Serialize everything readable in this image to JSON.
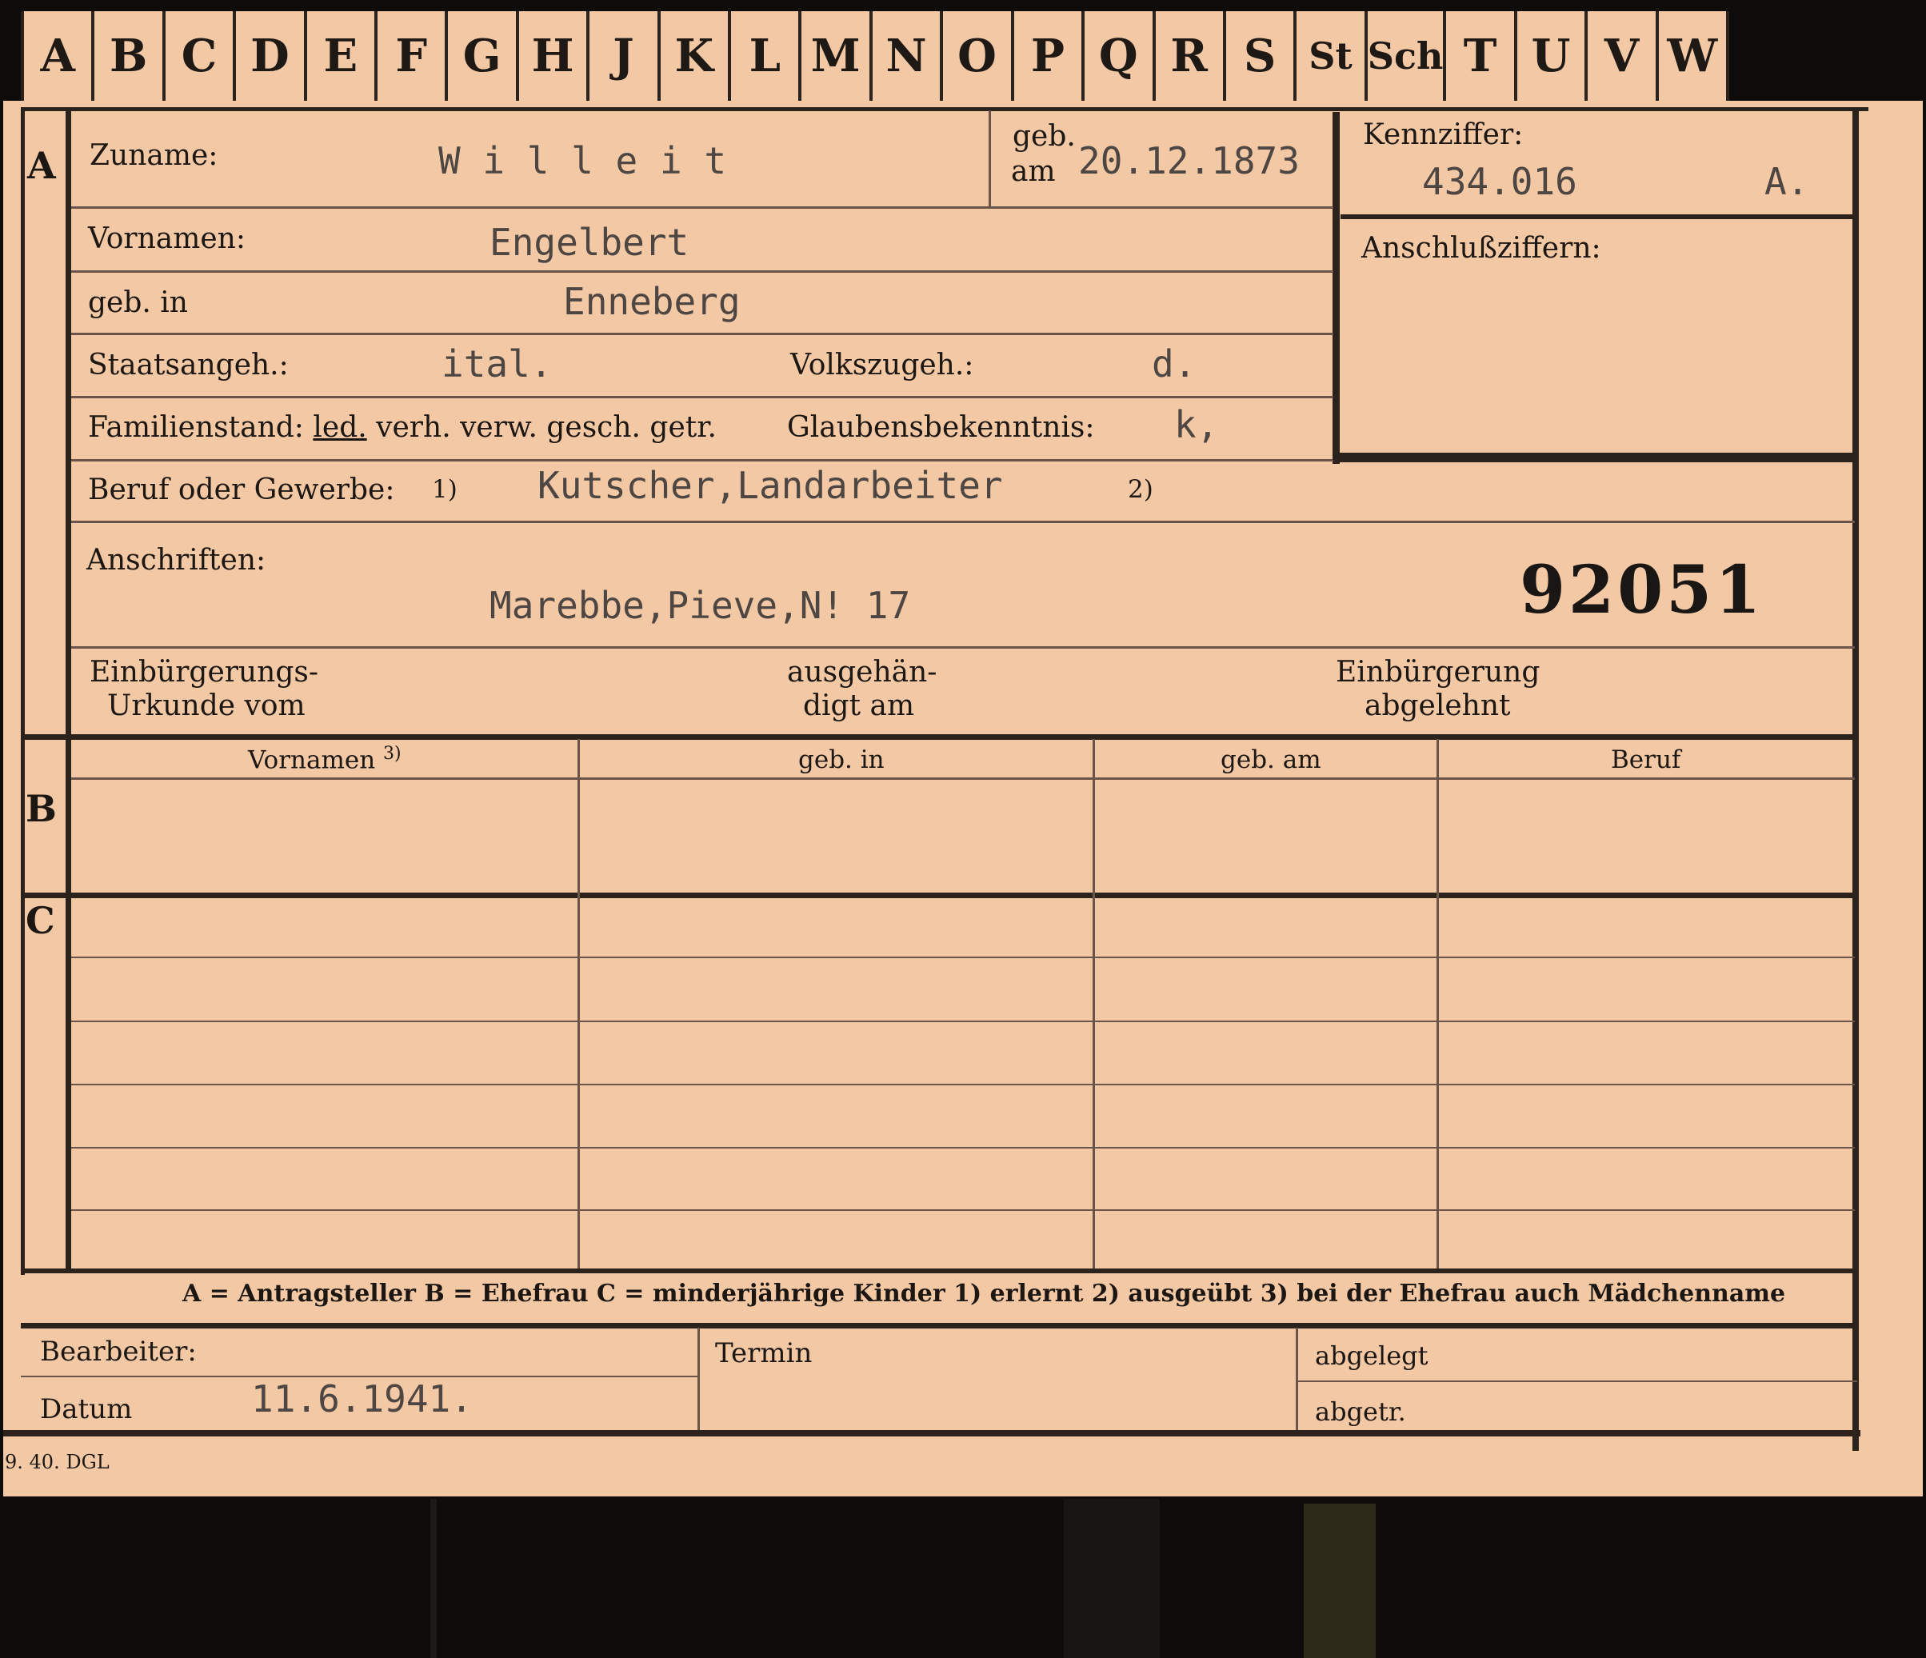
{
  "tabs": [
    "A",
    "B",
    "C",
    "D",
    "E",
    "F",
    "G",
    "H",
    "J",
    "K",
    "L",
    "M",
    "N",
    "O",
    "P",
    "Q",
    "R",
    "S",
    "St",
    "Sch",
    "T",
    "U",
    "V",
    "W"
  ],
  "sections": {
    "a": "A",
    "b": "B",
    "c": "C"
  },
  "person": {
    "surname_label": "Zuname:",
    "surname": "W i l l e i t",
    "birth_date_label_1": "geb.",
    "birth_date_label_2": "am",
    "birth_date": "20.12.1873",
    "kennziffer_label": "Kennziffer:",
    "kennziffer": "434.016",
    "kennziffer_suffix": "A.",
    "anschluss_label": "Anschlußziffern:",
    "firstnames_label": "Vornamen:",
    "firstnames": "Engelbert",
    "birthplace_label": "geb. in",
    "birthplace": "Enneberg",
    "citizenship_label": "Staatsangeh.:",
    "citizenship": "ital.",
    "ethnicity_label": "Volkszugeh.:",
    "ethnicity": "d.",
    "family_label": "Familienstand:",
    "family_led": "led.",
    "family_rest": "verh. verw. gesch. getr.",
    "religion_label": "Glaubensbekenntnis:",
    "religion": "k,",
    "occupation_label": "Beruf oder Gewerbe:",
    "occupation_note1": "1)",
    "occupation": "Kutscher,Landarbeiter",
    "occupation_note2": "2)",
    "address_label": "Anschriften:",
    "address": "Marebbe,Pieve,N! 17",
    "file_number": "92051",
    "naturalization_doc_1": "Einbürgerungs-",
    "naturalization_doc_2": "Urkunde vom",
    "handed_1": "ausgehän-",
    "handed_2": "digt am",
    "naturalization_denied_1": "Einbürgerung",
    "naturalization_denied_2": "abgelehnt"
  },
  "family_table": {
    "headers": [
      "Vornamen",
      "geb. in",
      "geb. am",
      "Beruf"
    ],
    "header_note": "3)"
  },
  "legend": "A = Antragsteller   B = Ehefrau   C = minderjährige Kinder   1) erlernt   2) ausgeübt   3) bei der Ehefrau auch Mädchenname",
  "footer": {
    "bearbeiter_label": "Bearbeiter:",
    "datum_label": "Datum",
    "datum": "11.6.1941.",
    "termin_label": "Termin",
    "abgelegt_label": "abgelegt",
    "abgetr_label": "abgetr."
  },
  "print_code": "9. 40. DGL"
}
